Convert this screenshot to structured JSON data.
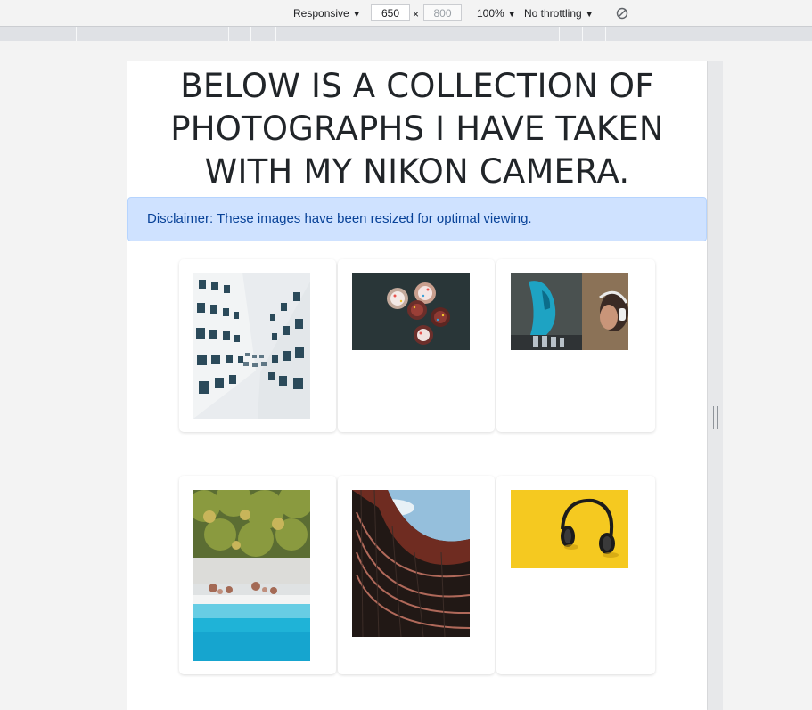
{
  "devtools": {
    "device_mode": "Responsive",
    "width": "650",
    "times": "×",
    "height": "800",
    "zoom": "100%",
    "throttling": "No throttling",
    "caret": "▼",
    "rotate_icon": "rotate-icon"
  },
  "page": {
    "title": "BELOW IS A COLLECTION OF PHOTOGRAPHS I HAVE TAKEN WITH MY NIKON CAMERA.",
    "alert": "Disclaimer: These images have been resized for optimal viewing."
  },
  "gallery": [
    {
      "subject": "building facade looking up",
      "orientation": "portrait"
    },
    {
      "subject": "cupcakes top view",
      "orientation": "landscape"
    },
    {
      "subject": "woman with headphones and graffiti",
      "orientation": "landscape"
    },
    {
      "subject": "aerial beach with palm trees",
      "orientation": "portrait"
    },
    {
      "subject": "curved building looking up",
      "orientation": "portrait"
    },
    {
      "subject": "headphones on yellow",
      "orientation": "landscape"
    }
  ],
  "colors": {
    "alert_bg": "#cfe2ff",
    "alert_text": "#084298",
    "title_text": "#212529"
  }
}
